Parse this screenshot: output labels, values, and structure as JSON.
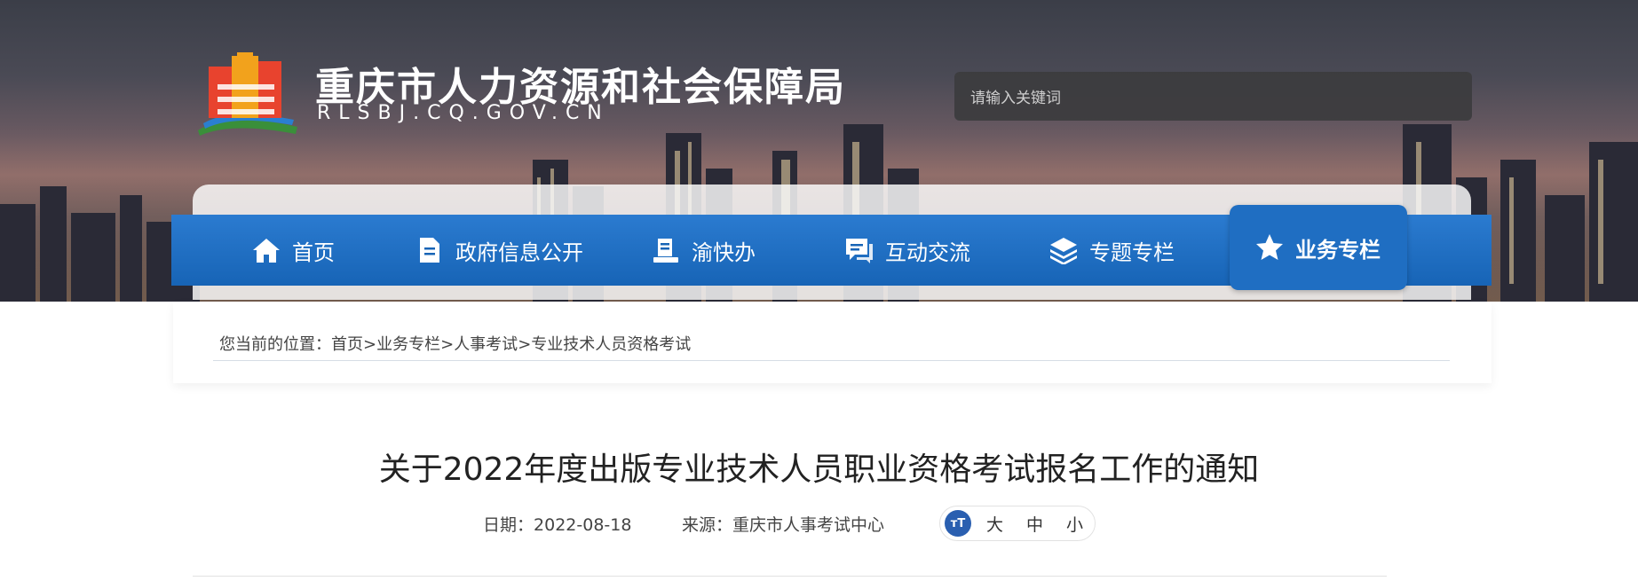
{
  "header": {
    "title": "重庆市人力资源和社会保障局",
    "domain": "RLSBJ.CQ.GOV.CN"
  },
  "search": {
    "placeholder": "请输入关键词"
  },
  "nav": {
    "items": [
      {
        "label": "首页",
        "icon": "home-icon"
      },
      {
        "label": "政府信息公开",
        "icon": "document-icon"
      },
      {
        "label": "渝快办",
        "icon": "service-icon"
      },
      {
        "label": "互动交流",
        "icon": "chat-icon"
      },
      {
        "label": "专题专栏",
        "icon": "layers-icon"
      },
      {
        "label": "业务专栏",
        "icon": "star-icon",
        "active": true
      }
    ],
    "active_color": "#1f6ec2",
    "bar_color": "#1764b6"
  },
  "breadcrumb": {
    "prefix": "您当前的位置：",
    "items": [
      "首页",
      "业务专栏",
      "人事考试",
      "专业技术人员资格考试"
    ],
    "separator": ">"
  },
  "article": {
    "title": "关于2022年度出版专业技术人员职业资格考试报名工作的通知",
    "date_label": "日期：",
    "date": "2022-08-18",
    "source_label": "来源：",
    "source": "重庆市人事考试中心",
    "font_size_options": [
      "大",
      "中",
      "小"
    ]
  }
}
